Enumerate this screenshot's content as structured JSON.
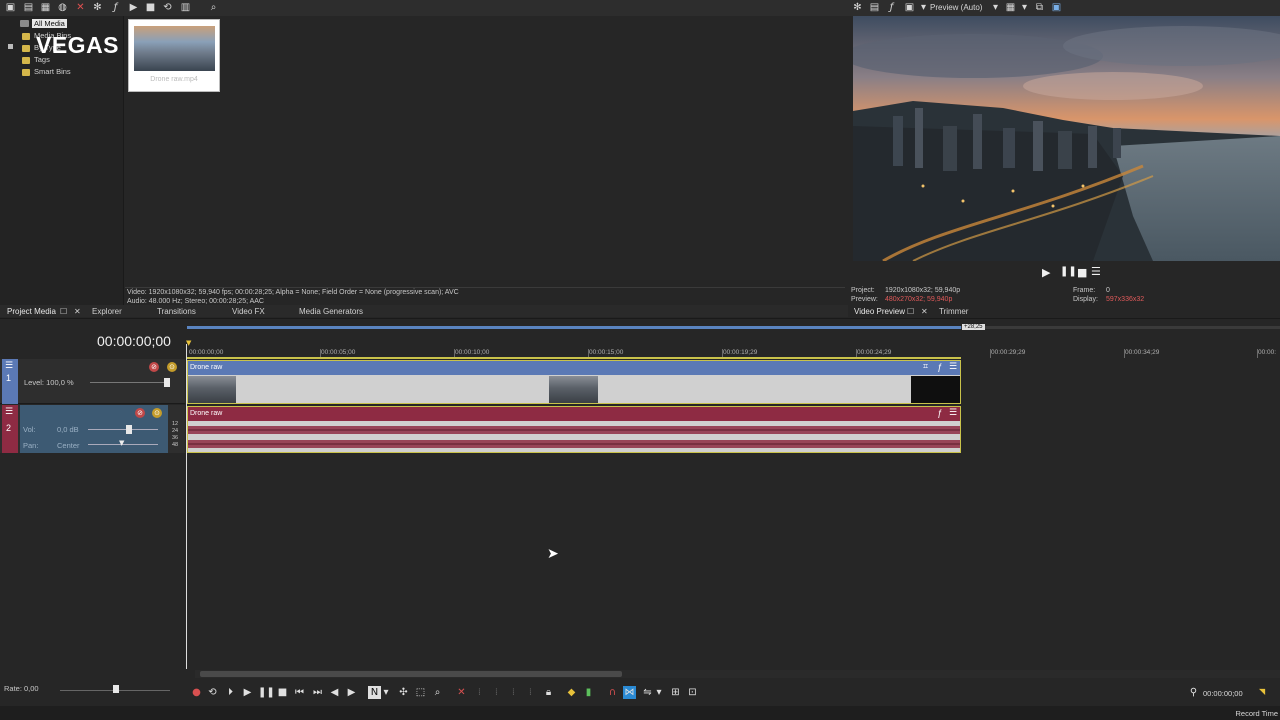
{
  "toolbar": {
    "icons": [
      "new-icon",
      "open-icon",
      "save-icon",
      "import-icon",
      "close-icon",
      "properties-icon",
      "fx-icon",
      "play-icon",
      "stop-icon",
      "loop-icon",
      "view-icon",
      "zoom-icon"
    ]
  },
  "media_tree": {
    "items": [
      "All Media",
      "Media Bins",
      "By Type",
      "Tags",
      "Smart Bins"
    ],
    "logo": "VEGAS"
  },
  "media_item": {
    "name": "Drone raw.mp4"
  },
  "media_info": {
    "line1": "Video: 1920x1080x32; 59,940 fps; 00:00:28;25; Alpha = None; Field Order = None (progressive scan); AVC",
    "line2": "Audio: 48.000 Hz; Stereo; 00:00:28;25; AAC"
  },
  "tabs": {
    "left": [
      "Project Media",
      "Explorer",
      "Transitions",
      "Video FX",
      "Media Generators"
    ],
    "right": [
      "Video Preview",
      "Trimmer"
    ]
  },
  "preview": {
    "mode_label": "Preview (Auto)",
    "project_label": "Project:",
    "project_value": "1920x1080x32; 59,940p",
    "preview_label": "Preview:",
    "preview_value": "480x270x32; 59,940p",
    "frame_label": "Frame:",
    "frame_value": "0",
    "display_label": "Display:",
    "display_value": "597x336x32"
  },
  "timeline": {
    "timecode": "00:00:00;00",
    "end_marker": "+28;25",
    "ruler": [
      "00:00:00;00",
      "00:00:05;00",
      "00:00:10;00",
      "00:00:15;00",
      "00:00:19;29",
      "00:00:24;29",
      "00:00:29;29",
      "00:00:34;29",
      "00:00:"
    ]
  },
  "tracks": {
    "video": {
      "number": "1",
      "level_label": "Level: 100,0 %",
      "clip_name": "Drone raw"
    },
    "audio": {
      "number": "2",
      "vol_label": "Vol:",
      "vol_value": "0,0 dB",
      "pan_label": "Pan:",
      "pan_value": "Center",
      "clip_name": "Drone raw",
      "meter": [
        "12",
        "24",
        "36",
        "48"
      ]
    }
  },
  "transport": {
    "rate_label": "Rate: 0,00",
    "cursor_time": "00:00:00;00",
    "record_time_label": "Record Time"
  },
  "colors": {
    "video_header": "#5b79b5",
    "audio_header": "#8e2b43",
    "track_selected": "#3d5a73",
    "accent": "#2a8ad4"
  }
}
